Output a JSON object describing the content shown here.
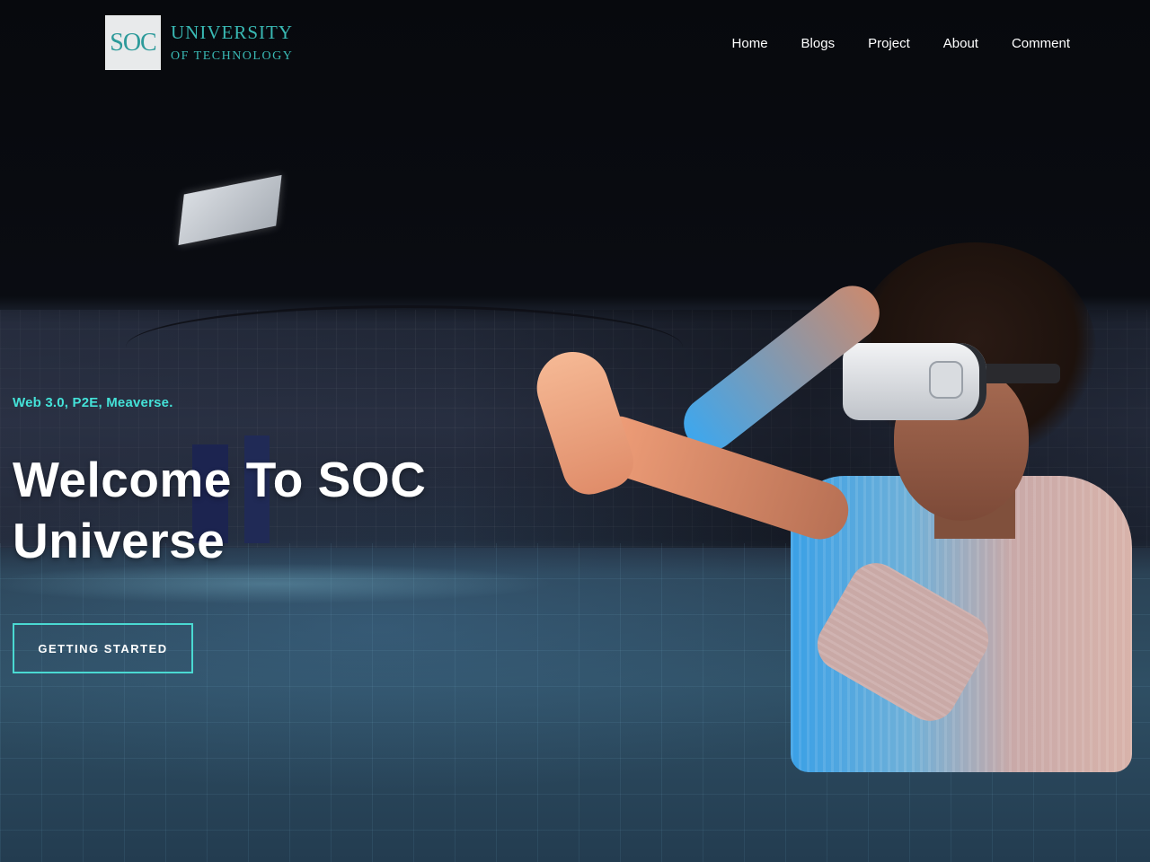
{
  "header": {
    "logo": {
      "mark": "SOC",
      "line1": "UNIVERSITY",
      "line2": "OF TECHNOLOGY"
    },
    "nav": [
      {
        "label": "Home"
      },
      {
        "label": "Blogs"
      },
      {
        "label": "Project"
      },
      {
        "label": "About"
      },
      {
        "label": "Comment"
      }
    ]
  },
  "hero": {
    "tagline": "Web 3.0, P2E, Meaverse.",
    "title": "Welcome To SOC Universe",
    "cta_label": "GETTING STARTED",
    "accent_color": "#44e2d8"
  }
}
